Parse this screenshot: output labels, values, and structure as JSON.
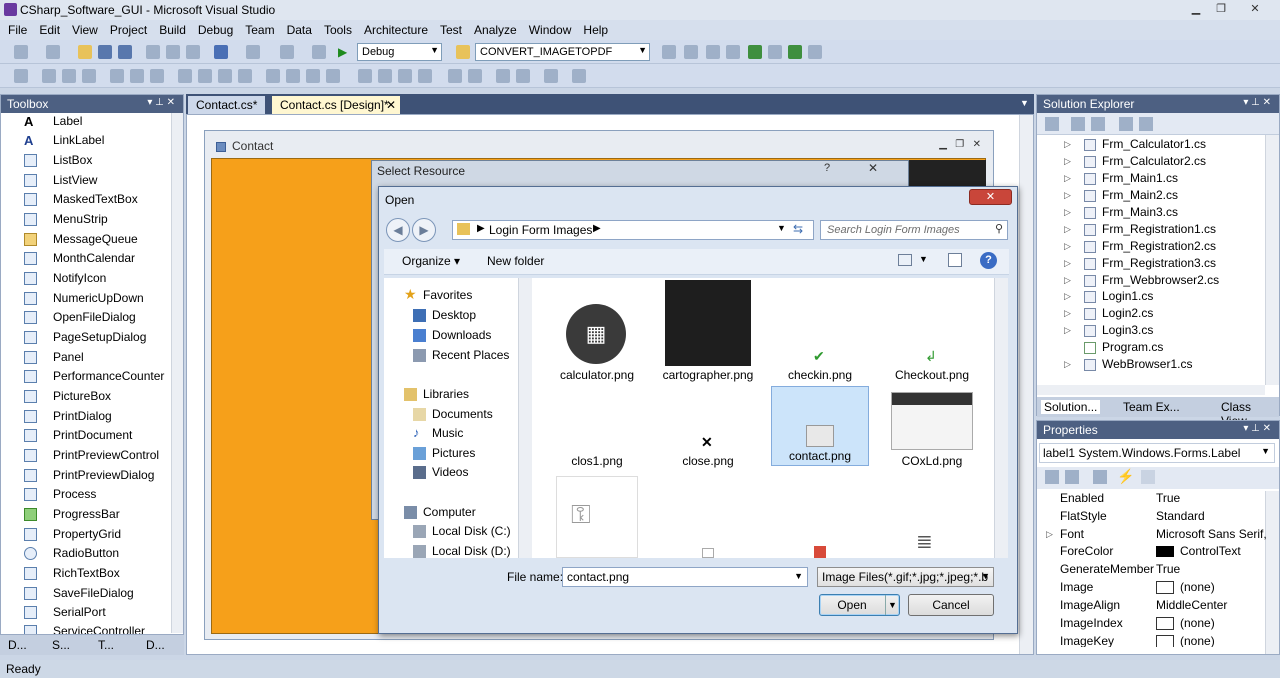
{
  "window": {
    "title": "CSharp_Software_GUI - Microsoft Visual Studio"
  },
  "menu": [
    "File",
    "Edit",
    "View",
    "Project",
    "Build",
    "Debug",
    "Team",
    "Data",
    "Tools",
    "Architecture",
    "Test",
    "Analyze",
    "Window",
    "Help"
  ],
  "toolbar": {
    "config": "Debug",
    "target": "CONVERT_IMAGETOPDF"
  },
  "toolbox": {
    "title": "Toolbox",
    "items": [
      "Label",
      "LinkLabel",
      "ListBox",
      "ListView",
      "MaskedTextBox",
      "MenuStrip",
      "MessageQueue",
      "MonthCalendar",
      "NotifyIcon",
      "NumericUpDown",
      "OpenFileDialog",
      "PageSetupDialog",
      "Panel",
      "PerformanceCounter",
      "PictureBox",
      "PrintDialog",
      "PrintDocument",
      "PrintPreviewControl",
      "PrintPreviewDialog",
      "Process",
      "ProgressBar",
      "PropertyGrid",
      "RadioButton",
      "RichTextBox",
      "SaveFileDialog",
      "SerialPort",
      "ServiceController"
    ]
  },
  "tabs": [
    "Contact.cs*",
    "Contact.cs [Design]*"
  ],
  "form": {
    "title": "Contact"
  },
  "select_resource": {
    "title": "Select Resource"
  },
  "open_dialog": {
    "title": "Open",
    "path": "Login Form Images",
    "search_placeholder": "Search Login Form Images",
    "organize": "Organize",
    "new_folder": "New folder",
    "favorites": "Favorites",
    "nav": [
      "Desktop",
      "Downloads",
      "Recent Places"
    ],
    "libraries": "Libraries",
    "lib_items": [
      "Documents",
      "Music",
      "Pictures",
      "Videos"
    ],
    "computer": "Computer",
    "drives": [
      "Local Disk (C:)",
      "Local Disk (D:)"
    ],
    "files": [
      "calculator.png",
      "cartographer.png",
      "checkin.png",
      "Checkout.png",
      "clos1.png",
      "close.png",
      "contact.png",
      "COxLd.png"
    ],
    "file_name_label": "File name:",
    "file_name": "contact.png",
    "filter": "Image Files(*.gif;*.jpg;*.jpeg;*.b",
    "open": "Open",
    "cancel": "Cancel"
  },
  "solution": {
    "title": "Solution Explorer",
    "items": [
      "Frm_Calculator1.cs",
      "Frm_Calculator2.cs",
      "Frm_Main1.cs",
      "Frm_Main2.cs",
      "Frm_Main3.cs",
      "Frm_Registration1.cs",
      "Frm_Registration2.cs",
      "Frm_Registration3.cs",
      "Frm_Webbrowser2.cs",
      "Login1.cs",
      "Login2.cs",
      "Login3.cs",
      "Program.cs",
      "WebBrowser1.cs"
    ],
    "tabs": [
      "Solution...",
      "Team Ex...",
      "Class View"
    ]
  },
  "properties": {
    "title": "Properties",
    "object": "label1 System.Windows.Forms.Label",
    "rows": [
      {
        "k": "Enabled",
        "v": "True"
      },
      {
        "k": "FlatStyle",
        "v": "Standard"
      },
      {
        "k": "Font",
        "v": "Microsoft Sans Serif,"
      },
      {
        "k": "ForeColor",
        "v": "ControlText"
      },
      {
        "k": "GenerateMember",
        "v": "True"
      },
      {
        "k": "Image",
        "v": "(none)"
      },
      {
        "k": "ImageAlign",
        "v": "MiddleCenter"
      },
      {
        "k": "ImageIndex",
        "v": "(none)"
      },
      {
        "k": "ImageKey",
        "v": "(none)"
      }
    ]
  },
  "bottom_tabs": [
    "D...",
    "S...",
    "T...",
    "D..."
  ],
  "status": "Ready",
  "colors": {
    "form_back": "#f6a01a",
    "panel_header": "#4d6082"
  }
}
